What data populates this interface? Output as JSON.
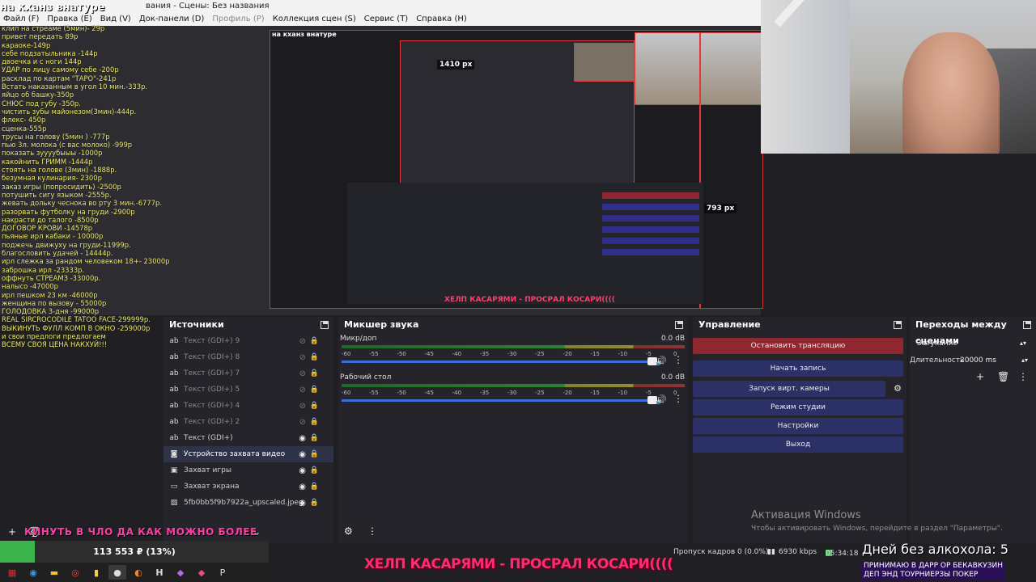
{
  "window": {
    "title": "вания - Сцены: Без названия"
  },
  "menu": {
    "items": [
      "Файл (F)",
      "Правка (E)",
      "Вид (V)",
      "Док-панели (D)",
      "Профиль (P)",
      "Коллекция сцен (S)",
      "Сервис (T)",
      "Справка (H)"
    ]
  },
  "overlay": {
    "title": "на кханз внатуре",
    "price_list": [
      "клип на стреаме (5мин)- 29р",
      "привет передать 89р",
      "караоке-149р",
      "себе подзатыльника -144р",
      "двоечка и с ноги 144р",
      "УДАР по лицу самому себе -200р",
      "расклад по картам \"ТАРО\"-241р",
      "Встать наказанным в угол 10 мин.-333р.",
      "яйцо об башку-350р",
      "СНЮС под губу -350р.",
      "чистить зубы майонезом(3мин)-444р.",
      "флекс- 450р",
      "сценка-555р",
      "трусы на голову (5мин ) -777р",
      "пью 3л. молока (с вас молоко) -999р",
      "показать зуууубыыы -1000р",
      "какойнить ГРИММ -1444р",
      "стоять на голове (3мин) -1888р.",
      "безумная кулинария- 2300р",
      "заказ игры (попросидить) -2500р",
      "потушить сигу языком -2555р.",
      "жевать дольку чеснока во рту 3 мин.-6777р.",
      "разорвать футболку на груди -2900р",
      "накрасти до талого -8500р",
      "ДОГОВОР КРОВИ -14578р",
      "пьяные ирл кабаки - 10000р",
      "поджечь движуху на груди-11999р.",
      "благословить удачей - 14444р.",
      "ирл слежка за рандом человеком 18+- 23000р",
      "заброшка ирл -23333р.",
      "оффнуть СТРЕАМЗ -33000р.",
      "налысо -47000р",
      "ирл пешком 23 км -46000р",
      "женщина по вызову - 55000р",
      "ГОЛОДОВКА 3-дня -99000р",
      "REAL SIRCROCODILE TATOO FACE-299999р.",
      "ВЫКИНУТЬ ФУЛЛ КОМП В ОКНО -259000р",
      "и свои предлоги предлогаем",
      "ВСЕМУ СВОЯ ЦЕНА НАКХУЙ!!!"
    ],
    "px_labels": [
      "1410 px",
      "793 px"
    ]
  },
  "sources": {
    "title": "Источники",
    "items": [
      {
        "icon": "ab",
        "name": "Текст (GDI+) 9",
        "visible": false
      },
      {
        "icon": "ab",
        "name": "Текст (GDI+) 8",
        "visible": false
      },
      {
        "icon": "ab",
        "name": "Текст (GDI+) 7",
        "visible": false
      },
      {
        "icon": "ab",
        "name": "Текст (GDI+) 5",
        "visible": false
      },
      {
        "icon": "ab",
        "name": "Текст (GDI+) 4",
        "visible": false
      },
      {
        "icon": "ab",
        "name": "Текст (GDI+) 2",
        "visible": false
      },
      {
        "icon": "ab",
        "name": "Текст (GDI+)",
        "visible": true
      },
      {
        "icon": "camera",
        "name": "Устройство захвата видео",
        "visible": true,
        "selected": true
      },
      {
        "icon": "gamepad",
        "name": "Захват игры",
        "visible": true
      },
      {
        "icon": "monitor",
        "name": "Захват экрана",
        "visible": true
      },
      {
        "icon": "image",
        "name": "5fb0bb5f9b7922a_upscaled.jpeg",
        "visible": true
      }
    ]
  },
  "mixer": {
    "title": "Микшер звука",
    "channels": [
      {
        "name": "Микр/доп",
        "db": "0.0 dB",
        "level": 0.91
      },
      {
        "name": "Рабочий стол",
        "db": "0.0 dB",
        "level": 0.91
      }
    ],
    "ticks": [
      "-60",
      "-55",
      "-50",
      "-45",
      "-40",
      "-35",
      "-30",
      "-25",
      "-20",
      "-15",
      "-10",
      "-5",
      "0"
    ]
  },
  "controls": {
    "title": "Управление",
    "buttons": {
      "stop_stream": "Остановить трансляцию",
      "start_record": "Начать запись",
      "virtual_cam": "Запуск вирт. камеры",
      "studio_mode": "Режим студии",
      "settings": "Настройки",
      "exit": "Выход"
    }
  },
  "transitions": {
    "title": "Переходы между сценами",
    "selected": "Затухание",
    "duration_label": "Длительность",
    "duration_value": "20000 ms"
  },
  "activation": {
    "title": "Активация Windows",
    "subtitle": "Чтобы активировать Windows, перейдите в раздел \"Параметры\"."
  },
  "scene_bar": {
    "ticker": "КИНУТЬ В ЧЛО ДА КАК МОЖНО БОЛЕЕ",
    "goal_text": "113 553 ₽ (13%)",
    "goal_progress": 0.13
  },
  "status": {
    "dropped_frames": "Пропуск кадров 0 (0.0%)",
    "bitrate": "6930 kbps",
    "time": "05:34:18"
  },
  "marquee": {
    "text": "ХЕЛП КАСАРЯМИ - ПРОСРАЛ КОСАРИ(((("
  },
  "days_counter": {
    "text": "Дней без алкохола: 5"
  },
  "promo": {
    "line1": "ПРИНИМАЮ В ДАРР ОР БЕКАВКУЗИН",
    "line2": "ДЕП ЭНД ТОУРНИЕРЗЫ ПОКЕР"
  },
  "colors": {
    "stop_button": "#8e2730",
    "primary_button": "#2b3067",
    "price_text": "#f1ed6c",
    "marquee": "#ff2c6f",
    "goal_fill": "#3ab44a"
  }
}
